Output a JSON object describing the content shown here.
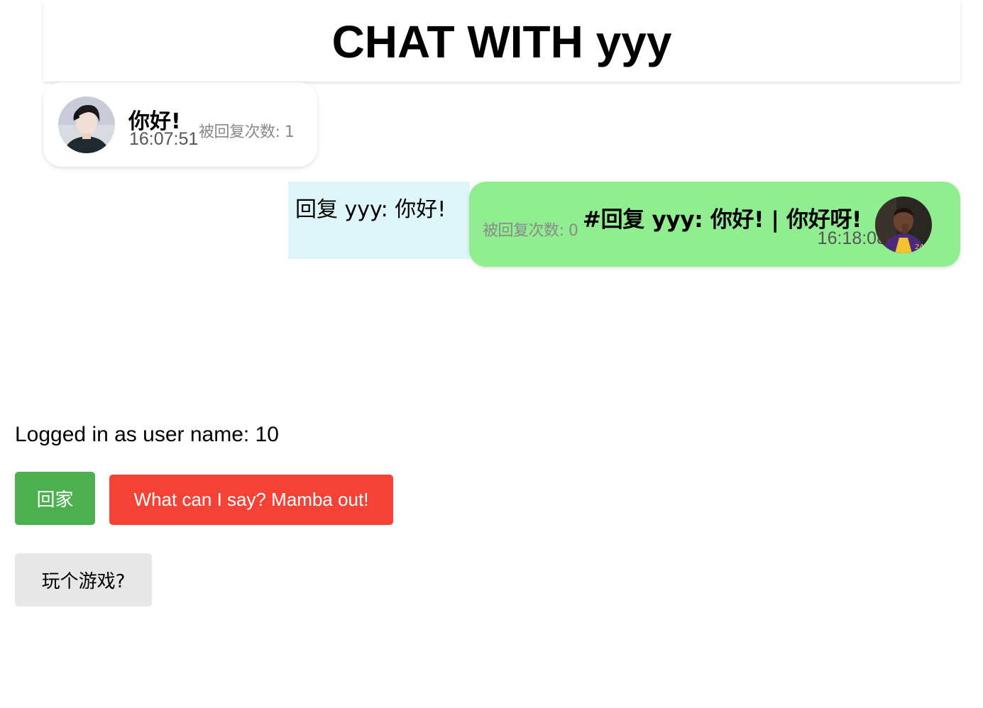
{
  "header": {
    "title": "CHAT WITH yyy"
  },
  "messages": [
    {
      "side": "left",
      "text": "你好!",
      "time": "16:07:51",
      "reply_count": "被回复次数: 1",
      "avatar": "user-avatar-photo"
    },
    {
      "side": "right",
      "quote": "回复 yyy: 你好!",
      "text": "#回复 yyy: 你好! | 你好呀!",
      "time": "16:18:08",
      "reply_count": "被回复次数: 0",
      "avatar": "user-avatar-photo"
    }
  ],
  "footer": {
    "logged_in": "Logged in as user name: 10",
    "home_button": "回家",
    "mamba_button": "What can I say? Mamba out!",
    "game_button": "玩个游戏?"
  },
  "colors": {
    "left_bubble": "#ffffff",
    "right_bubble": "#90ee90",
    "quote_bg": "#def6f8",
    "home_button": "#4caf50",
    "mamba_button": "#f44336",
    "game_button": "#e7e7e7"
  }
}
